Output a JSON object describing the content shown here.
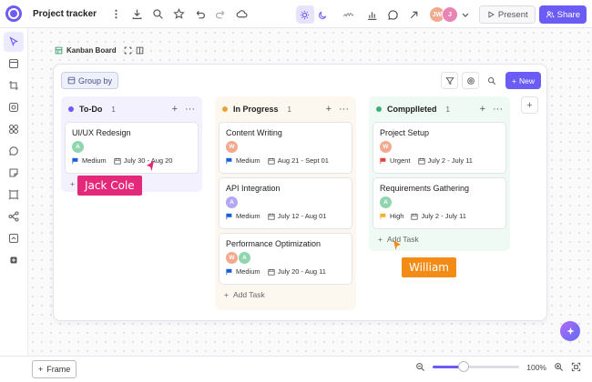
{
  "app": {
    "title": "Project tracker",
    "present_label": "Present",
    "share_label": "Share",
    "avatars": [
      {
        "initials": "JW",
        "color": "#f2a98e"
      },
      {
        "initials": "J",
        "color": "#e985b5"
      }
    ]
  },
  "frame": {
    "label": "Kanban Board",
    "group_by_label": "Group by",
    "new_label": "New"
  },
  "columns": [
    {
      "name": "To-Do",
      "count": "1",
      "color": "#6a5cf5",
      "bg": "#f2f1fd",
      "cards": [
        {
          "title": "UI/UX Redesign",
          "avatars": [
            {
              "initials": "A",
              "color": "#8fd6b0"
            }
          ],
          "priority": "Medium",
          "priority_color": "#1a5fd6",
          "dates": "July 30 - Aug 20"
        }
      ],
      "add_label": ""
    },
    {
      "name": "In Progress",
      "count": "1",
      "color": "#e8a33b",
      "bg": "#fdf8ef",
      "cards": [
        {
          "title": "Content Writing",
          "avatars": [
            {
              "initials": "W",
              "color": "#f2a98e"
            }
          ],
          "priority": "Medium",
          "priority_color": "#1a5fd6",
          "dates": "Aug 21 - Sept 01"
        },
        {
          "title": "API Integration",
          "avatars": [
            {
              "initials": "A",
              "color": "#b3a8f3"
            }
          ],
          "priority": "Medium",
          "priority_color": "#1a5fd6",
          "dates": "July 12 - Aug 01"
        },
        {
          "title": "Performance Optimization",
          "avatars": [
            {
              "initials": "W",
              "color": "#f2a98e"
            },
            {
              "initials": "A",
              "color": "#8fd6b0"
            }
          ],
          "priority": "Medium",
          "priority_color": "#1a5fd6",
          "dates": "July 20 - Aug 11"
        }
      ],
      "add_label": "Add Task"
    },
    {
      "name": "Compplleted",
      "count": "1",
      "color": "#3dae7c",
      "bg": "#effaf4",
      "cards": [
        {
          "title": "Project Setup",
          "avatars": [
            {
              "initials": "W",
              "color": "#f2a98e"
            }
          ],
          "priority": "Urgent",
          "priority_color": "#e0453b",
          "dates": "July 2 - July 11"
        },
        {
          "title": "Requirements Gathering",
          "avatars": [
            {
              "initials": "A",
              "color": "#8fd6b0"
            }
          ],
          "priority": "High",
          "priority_color": "#f0b429",
          "dates": "July 2 - July 11"
        }
      ],
      "add_label": "Add Task"
    }
  ],
  "cursors": [
    {
      "name": "Jack Cole",
      "color": "#e5297a"
    },
    {
      "name": "William",
      "color": "#f28c16"
    }
  ],
  "bottom": {
    "frame_label": "Frame",
    "zoom_label": "100%",
    "zoom_fraction": 0.36
  }
}
